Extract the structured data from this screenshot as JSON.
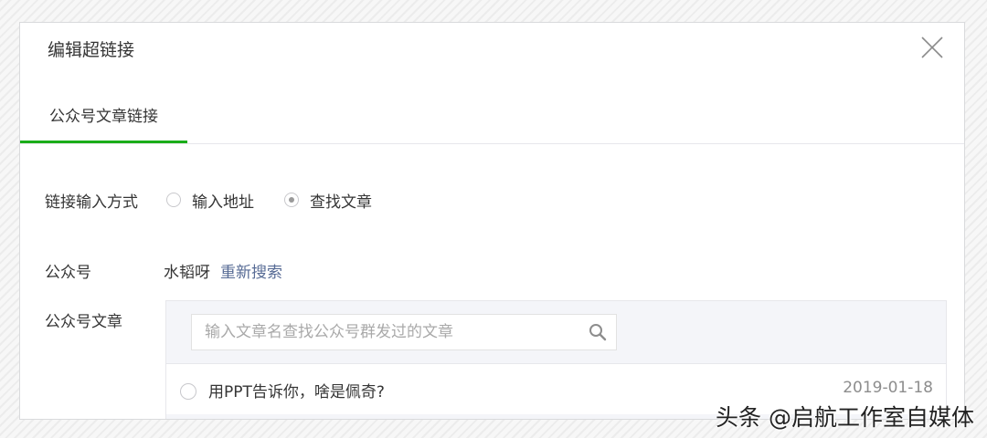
{
  "dialog": {
    "title": "编辑超链接",
    "close_icon": "close-icon"
  },
  "tabs": [
    {
      "label": "公众号文章链接",
      "active": true
    }
  ],
  "link_mode": {
    "label": "链接输入方式",
    "options": [
      {
        "label": "输入地址",
        "checked": false
      },
      {
        "label": "查找文章",
        "checked": true
      }
    ]
  },
  "account": {
    "label": "公众号",
    "name": "水韬呀",
    "research_link": "重新搜索"
  },
  "articles": {
    "label": "公众号文章",
    "search_placeholder": "输入文章名查找公众号群发过的文章",
    "search_value": "",
    "search_icon": "search-icon",
    "items": [
      {
        "title": "用PPT告诉你，啥是佩奇?",
        "date": "2019-01-18",
        "checked": false
      }
    ]
  },
  "watermark": "头条 @启航工作室自媒体",
  "colors": {
    "accent_green": "#1aad19",
    "link_blue": "#576b95",
    "panel_bg": "#f4f5f9"
  }
}
